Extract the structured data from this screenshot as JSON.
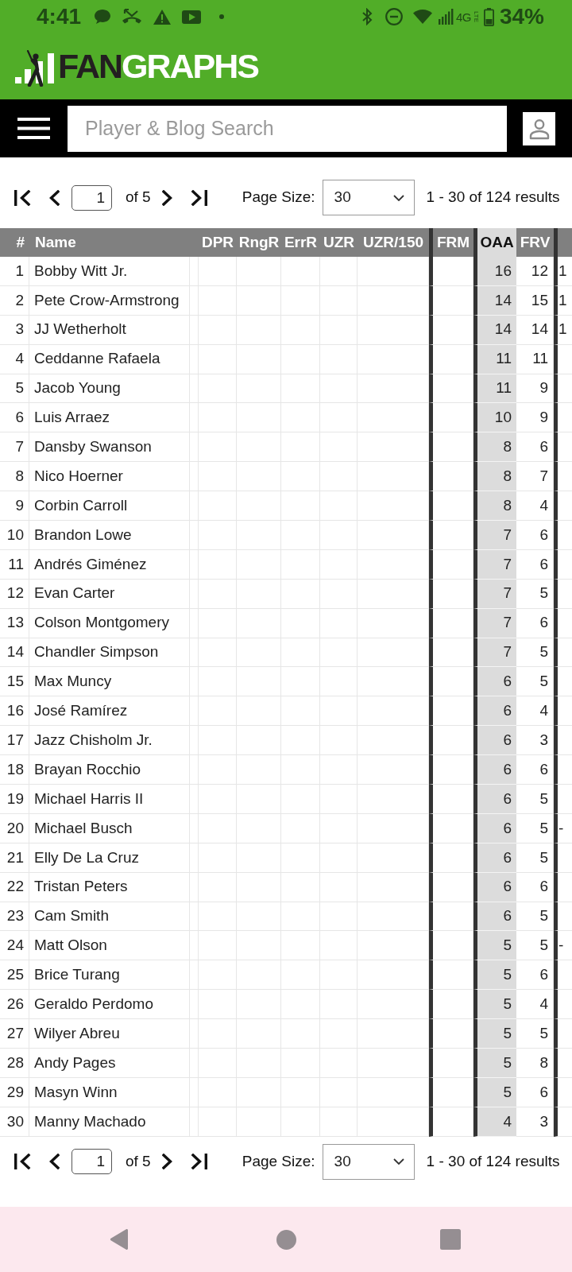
{
  "status_bar": {
    "time": "4:41",
    "network": "4G",
    "network_type": "LTE",
    "battery": "34%"
  },
  "header": {
    "logo_dark": "FAN",
    "logo_light": "GRAPHS",
    "search": {
      "placeholder": "Player & Blog Search"
    }
  },
  "pagination_top": {
    "page": "1",
    "total": "of 5",
    "page_size_label": "Page Size:",
    "page_size": "30",
    "results": "1 - 30 of 124 results"
  },
  "table": {
    "columns": [
      {
        "label": "#",
        "sorted": false
      },
      {
        "label": "Name",
        "sorted": false
      },
      {
        "sorted": false
      },
      {
        "label": "DPR",
        "sorted": false
      },
      {
        "label": "RngR",
        "sorted": false
      },
      {
        "label": "ErrR",
        "sorted": false
      },
      {
        "label": "UZR",
        "sorted": false
      },
      {
        "label": "UZR/150",
        "sorted": false
      },
      {
        "label": "FRM",
        "sorted": false
      },
      {
        "label": "OAA",
        "sorted": true
      },
      {
        "label": "FRV",
        "sorted": false
      },
      {
        "sorted": false
      }
    ],
    "rows": [
      {
        "rank": "1",
        "name": "Bobby Witt Jr.",
        "oaa": "16",
        "frv": "12",
        "column_12": "1"
      },
      {
        "rank": "2",
        "name": "Pete Crow-Armstrong",
        "oaa": "14",
        "frv": "15",
        "column_12": "1"
      },
      {
        "rank": "3",
        "name": "JJ Wetherholt",
        "oaa": "14",
        "frv": "14",
        "column_12": "1"
      },
      {
        "rank": "4",
        "name": "Ceddanne Rafaela",
        "oaa": "11",
        "frv": "11"
      },
      {
        "rank": "5",
        "name": "Jacob Young",
        "oaa": "11",
        "frv": "9"
      },
      {
        "rank": "6",
        "name": "Luis Arraez",
        "oaa": "10",
        "frv": "9"
      },
      {
        "rank": "7",
        "name": "Dansby Swanson",
        "oaa": "8",
        "frv": "6"
      },
      {
        "rank": "8",
        "name": "Nico Hoerner",
        "oaa": "8",
        "frv": "7"
      },
      {
        "rank": "9",
        "name": "Corbin Carroll",
        "oaa": "8",
        "frv": "4"
      },
      {
        "rank": "10",
        "name": "Brandon Lowe",
        "oaa": "7",
        "frv": "6"
      },
      {
        "rank": "11",
        "name": "Andrés Giménez",
        "oaa": "7",
        "frv": "6"
      },
      {
        "rank": "12",
        "name": "Evan Carter",
        "oaa": "7",
        "frv": "5"
      },
      {
        "rank": "13",
        "name": "Colson Montgomery",
        "oaa": "7",
        "frv": "6"
      },
      {
        "rank": "14",
        "name": "Chandler Simpson",
        "oaa": "7",
        "frv": "5"
      },
      {
        "rank": "15",
        "name": "Max Muncy",
        "oaa": "6",
        "frv": "5"
      },
      {
        "rank": "16",
        "name": "José Ramírez",
        "oaa": "6",
        "frv": "4"
      },
      {
        "rank": "17",
        "name": "Jazz Chisholm Jr.",
        "oaa": "6",
        "frv": "3"
      },
      {
        "rank": "18",
        "name": "Brayan Rocchio",
        "oaa": "6",
        "frv": "6"
      },
      {
        "rank": "19",
        "name": "Michael Harris II",
        "oaa": "6",
        "frv": "5"
      },
      {
        "rank": "20",
        "name": "Michael Busch",
        "oaa": "6",
        "frv": "5",
        "column_12": "-"
      },
      {
        "rank": "21",
        "name": "Elly De La Cruz",
        "oaa": "6",
        "frv": "5"
      },
      {
        "rank": "22",
        "name": "Tristan Peters",
        "oaa": "6",
        "frv": "6"
      },
      {
        "rank": "23",
        "name": "Cam Smith",
        "oaa": "6",
        "frv": "5"
      },
      {
        "rank": "24",
        "name": "Matt Olson",
        "oaa": "5",
        "frv": "5",
        "column_12": "-"
      },
      {
        "rank": "25",
        "name": "Brice Turang",
        "oaa": "5",
        "frv": "6"
      },
      {
        "rank": "26",
        "name": "Geraldo Perdomo",
        "oaa": "5",
        "frv": "4"
      },
      {
        "rank": "27",
        "name": "Wilyer Abreu",
        "oaa": "5",
        "frv": "5"
      },
      {
        "rank": "28",
        "name": "Andy Pages",
        "oaa": "5",
        "frv": "8"
      },
      {
        "rank": "29",
        "name": "Masyn Winn",
        "oaa": "5",
        "frv": "6"
      },
      {
        "rank": "30",
        "name": "Manny Machado",
        "oaa": "4",
        "frv": "3"
      }
    ]
  },
  "pagination_bottom": {
    "page": "1",
    "total": "of 5",
    "page_size_label": "Page Size:",
    "page_size": "30",
    "results": "1 - 30 of 124 results"
  }
}
